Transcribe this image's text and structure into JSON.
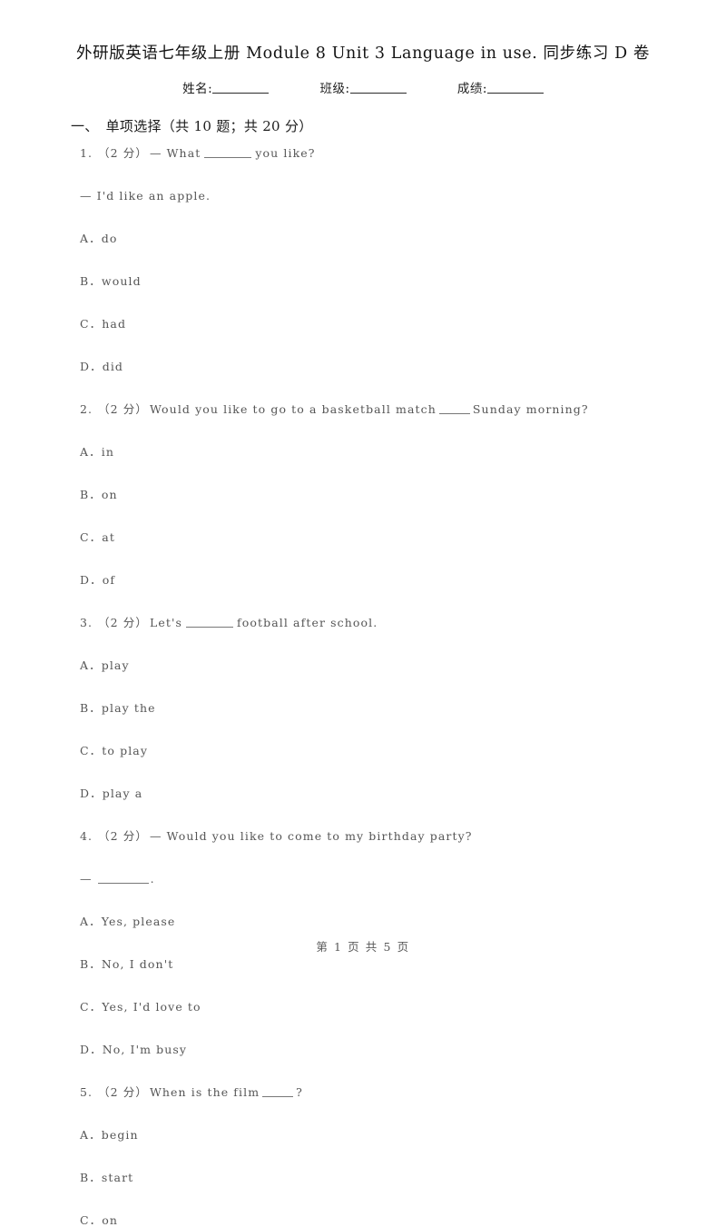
{
  "document": {
    "title": "外研版英语七年级上册 Module 8 Unit 3 Language in use. 同步练习 D 卷"
  },
  "info_line": {
    "fields": [
      {
        "label": "姓名:"
      },
      {
        "label": "班级:"
      },
      {
        "label": "成绩:"
      }
    ]
  },
  "section": {
    "index": "一、",
    "title": "单项选择（共 10 题；共 20 分）"
  },
  "questions": [
    {
      "number": "1.",
      "score": "（2 分）",
      "stem": "— What",
      "stem_tail": "you like?",
      "extra_line": "— I'd like an apple.",
      "options": [
        {
          "letter": "A．",
          "text": "do"
        },
        {
          "letter": "B．",
          "text": "would"
        },
        {
          "letter": "C．",
          "text": "had"
        },
        {
          "letter": "D．",
          "text": "did"
        }
      ]
    },
    {
      "number": "2.",
      "score": "（2 分）",
      "stem": "Would you like to go to a basketball match",
      "stem_tail": "Sunday morning?",
      "options": [
        {
          "letter": "A．",
          "text": "in"
        },
        {
          "letter": "B．",
          "text": "on"
        },
        {
          "letter": "C．",
          "text": "at"
        },
        {
          "letter": "D．",
          "text": "of"
        }
      ]
    },
    {
      "number": "3.",
      "score": "（2 分）",
      "stem": "Let's",
      "stem_tail": "football after school.",
      "options": [
        {
          "letter": "A．",
          "text": "play"
        },
        {
          "letter": "B．",
          "text": "play the"
        },
        {
          "letter": "C．",
          "text": "to play"
        },
        {
          "letter": "D．",
          "text": "play a"
        }
      ]
    },
    {
      "number": "4.",
      "score": "（2 分）",
      "stem": "— Would you like to come to my birthday party?",
      "answer_prefix": "—",
      "answer_suffix": ".",
      "options": [
        {
          "letter": "A．",
          "text": "Yes, please"
        },
        {
          "letter": "B．",
          "text": "No, I don't"
        },
        {
          "letter": "C．",
          "text": "Yes, I'd love to"
        },
        {
          "letter": "D．",
          "text": "No, I'm busy"
        }
      ]
    },
    {
      "number": "5.",
      "score": "（2 分）",
      "stem": "When is the film",
      "stem_tail": "?",
      "options": [
        {
          "letter": "A．",
          "text": "begin"
        },
        {
          "letter": "B．",
          "text": "start"
        },
        {
          "letter": "C．",
          "text": "on"
        }
      ]
    }
  ],
  "footer": {
    "text": "第 1 页 共 5 页"
  }
}
